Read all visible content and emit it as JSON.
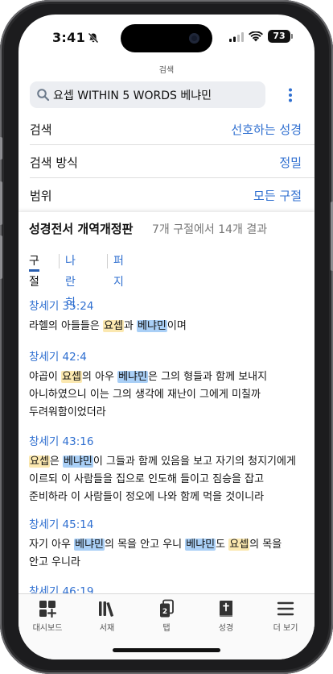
{
  "status": {
    "time": "3:41",
    "battery": "73"
  },
  "nav": {
    "title": "검색"
  },
  "search": {
    "query": "요셉 WITHIN 5 WORDS 베냐민"
  },
  "options": [
    {
      "label": "검색",
      "value": "선호하는 성경"
    },
    {
      "label": "검색 방식",
      "value": "정밀"
    },
    {
      "label": "범위",
      "value": "모든 구절"
    }
  ],
  "results": {
    "bible": "성경전서 개역개정판",
    "summary": "7개 구절에서 14개 결과",
    "tabs": [
      "구절",
      "나란히",
      "퍼지"
    ],
    "active_tab": "구절",
    "verses": [
      {
        "ref": "창세기 35:24",
        "text": "라헬의 아들들은 요셉과 베냐민이며"
      },
      {
        "ref": "창세기 42:4",
        "text": "야곱이 요셉의 아우 베냐민은 그의 형들과 함께 보내지 아니하였으니 이는 그의 생각에 재난이 그에게 미칠까 두려워함이었더라"
      },
      {
        "ref": "창세기 43:16",
        "text": "요셉은 베냐민이 그들과 함께 있음을 보고 자기의 청지기에게 이르되 이 사람들을 집으로 인도해 들이고 짐승을 잡고 준비하라 이 사람들이 정오에 나와 함께 먹을 것이니라"
      },
      {
        "ref": "창세기 45:14",
        "text": "자기 아우 베냐민의 목을 안고 우니 베냐민도 요셉의 목을 안고 우니라"
      },
      {
        "ref": "창세기 46:19",
        "text": ""
      }
    ]
  },
  "tabbar": [
    {
      "label": "대시보드",
      "icon": "dashboard-icon"
    },
    {
      "label": "서재",
      "icon": "library-icon"
    },
    {
      "label": "탭",
      "icon": "tabs-icon",
      "badge": "2"
    },
    {
      "label": "성경",
      "icon": "bible-icon"
    },
    {
      "label": "더 보기",
      "icon": "menu-icon"
    }
  ],
  "colors": {
    "accent": "#2f6fd0",
    "highlight_joseph": "#fbe8b0",
    "highlight_benjamin": "#a9cff6"
  }
}
